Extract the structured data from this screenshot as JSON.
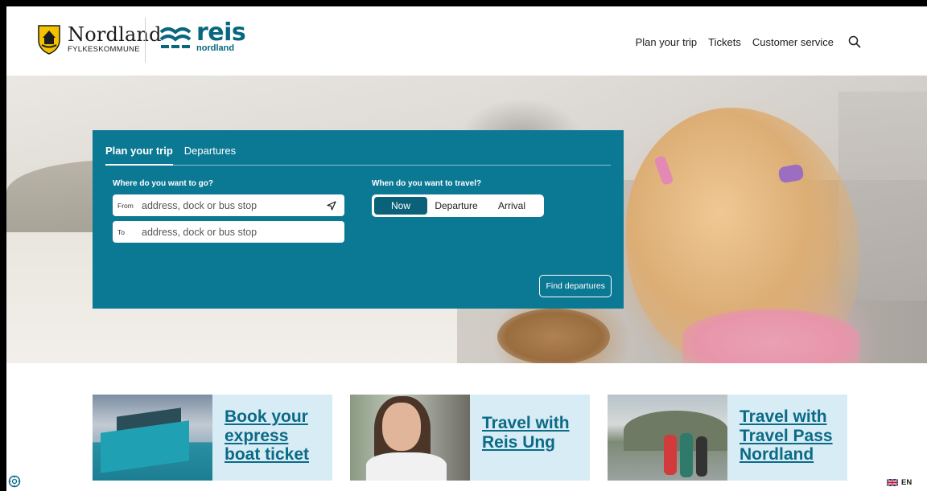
{
  "header": {
    "logo_nordland": "Nordland",
    "logo_fylke": "FYLKESKOMMUNE",
    "logo_reis": "reis",
    "logo_reis_sub": "nordland",
    "nav": [
      "Plan your trip",
      "Tickets",
      "Customer service"
    ],
    "search_icon": "search-icon"
  },
  "planner": {
    "tabs": [
      "Plan your trip",
      "Departures"
    ],
    "where_label": "Where do you want to go?",
    "from_prefix": "From",
    "from_placeholder": "address, dock or bus stop",
    "to_prefix": "To",
    "to_placeholder": "address, dock or bus stop",
    "when_label": "When do you want to travel?",
    "time_options": [
      "Now",
      "Departure",
      "Arrival"
    ],
    "find_button": "Find departures"
  },
  "cards": [
    {
      "title_lines": [
        "Book your",
        "express",
        "boat ticket"
      ]
    },
    {
      "title_lines": [
        "Travel with",
        "Reis Ung"
      ]
    },
    {
      "title_lines": [
        "Travel with",
        "Travel Pass",
        "Nordland"
      ]
    }
  ],
  "language": "EN",
  "colors": {
    "panel": "#0b7994",
    "active_segment": "#0b6178",
    "card_bg": "#d7ecf4",
    "card_link": "#0b6a86",
    "brand": "#07677f"
  }
}
